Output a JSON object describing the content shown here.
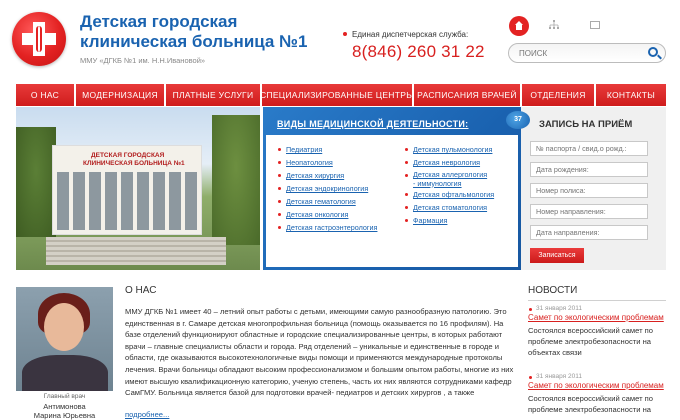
{
  "header": {
    "title_line1": "Детская городская",
    "title_line2": "клиническая больница №1",
    "subtitle": "ММУ «ДГКБ №1 им. Н.Н.Ивановой»",
    "dispatch_label": "Единая диспетчерская служба:",
    "phone": "8(846) 260 31 22",
    "search_placeholder": "ПОИСК"
  },
  "nav": {
    "items": [
      {
        "label": "О НАС"
      },
      {
        "label": "МОДЕРНИЗАЦИЯ"
      },
      {
        "label": "ПЛАТНЫЕ УСЛУГИ"
      },
      {
        "label": "СПЕЦИАЛИЗИРОВАННЫЕ ЦЕНТРЫ"
      },
      {
        "label": "РАСПИСАНИЯ ВРАЧЕЙ"
      },
      {
        "label": "ОТДЕЛЕНИЯ"
      },
      {
        "label": "КОНТАКТЫ"
      }
    ]
  },
  "banner": {
    "building_sign_line1": "ДЕТСКАЯ ГОРОДСКАЯ",
    "building_sign_line2": "КЛИНИЧЕСКАЯ БОЛЬНИЦА №1",
    "heading": "ВИДЫ МЕДИЦИНСКОЙ ДЕЯТЕЛЬНОСТИ:",
    "left_items": [
      "Педиатрия",
      "Неопатология",
      "Детская хирургия",
      "Детская эндокринология",
      "Детская гематология",
      "Детская онкология",
      "Детская гастроэнтерология"
    ],
    "right_items": [
      "Детская пульмонология",
      "Детская неврология",
      "Детская аллергология",
      "- иммунология",
      "Детская офтальмология",
      "Детская стоматология",
      "Фармация"
    ]
  },
  "appointment": {
    "badge": "37",
    "title": "ЗАПИСЬ НА ПРИЁМ",
    "fields": [
      "№ паспорта / свид.о рожд.:",
      "Дата рождения:",
      "Номер полиса:",
      "Номер направления:",
      "Дата направления:"
    ],
    "submit_label": "Записаться"
  },
  "staff": {
    "role": "Главный врач",
    "surname": "Антимонова",
    "name": "Марина Юрьевна"
  },
  "about": {
    "heading": "О НАС",
    "text": "ММУ ДГКБ №1 имеет 40 – летний опыт работы с детьми, имеющими самую разнообразную патологию. Это единственная в г. Самаре детская многопрофильная больница (помощь оказывается по 16 профилям). На базе отделений функционируют областные и городские специализированные центры, в которых работают врачи – главные специалисты области и города. Ряд отделений – уникальные и единственные в городе и области, где оказываются высокотехнологичные виды помощи и применяются международные протоколы лечения. Врачи больницы обладают высоким профессионализмом и большим опытом работы, многие из них имеют высшую квалификационную категорию, ученую степень, часть их них являются сотрудниками кафедр СамГМУ. Больница является базой для подготовки врачей- педиатров и детских хирургов , а также",
    "more_label": "подробнее..."
  },
  "news": {
    "heading": "НОВОСТИ",
    "items": [
      {
        "date": "31 января 2011",
        "title": "Самет по экологическим проблемам",
        "body": "Состоялся всероссийский самет по проблеме электробезопасности на объектах связи"
      },
      {
        "date": "31 января 2011",
        "title": "Самет по экологическим проблемам",
        "body": "Состоялся всероссийский самет по проблеме электробезопасности на"
      }
    ]
  },
  "colors": {
    "brand_red": "#e32222",
    "brand_blue": "#1a63b0"
  }
}
